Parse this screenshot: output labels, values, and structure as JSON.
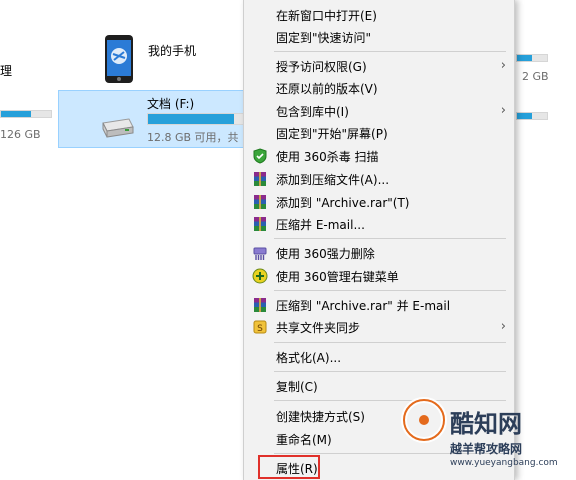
{
  "explorer": {
    "left_partial_text": "理",
    "left_partial_size": "126 GB",
    "phone": {
      "label": "我的手机"
    },
    "drive": {
      "label": "文档 (F:)",
      "free_text": "12.8 GB 可用，共",
      "usage": 0.88
    },
    "right_partial_size": "2 GB",
    "right_bars": [
      {
        "usage": 0.5
      },
      {
        "usage": 0.5
      }
    ]
  },
  "context_menu": {
    "items": [
      {
        "label": "在新窗口中打开(E)",
        "icon": ""
      },
      {
        "label": "固定到\"快速访问\"",
        "icon": ""
      },
      {
        "label": "授予访问权限(G)",
        "icon": "",
        "submenu": true
      },
      {
        "label": "还原以前的版本(V)",
        "icon": ""
      },
      {
        "label": "包含到库中(I)",
        "icon": "",
        "submenu": true
      },
      {
        "label": "固定到\"开始\"屏幕(P)",
        "icon": ""
      },
      {
        "label": "使用 360杀毒 扫描",
        "icon": "shield-icon"
      },
      {
        "label": "添加到压缩文件(A)...",
        "icon": "winrar-icon"
      },
      {
        "label": "添加到 \"Archive.rar\"(T)",
        "icon": "winrar-icon"
      },
      {
        "label": "压缩并 E-mail...",
        "icon": "winrar-icon"
      },
      {
        "label": "使用 360强力删除",
        "icon": "shredder-icon"
      },
      {
        "label": "使用 360管理右键菜单",
        "icon": "context-manager-icon"
      },
      {
        "label": "压缩到 \"Archive.rar\" 并 E-mail",
        "icon": "winrar-icon"
      },
      {
        "label": "共享文件夹同步",
        "icon": "sync-icon",
        "submenu": true
      },
      {
        "label": "格式化(A)...",
        "icon": ""
      },
      {
        "label": "复制(C)",
        "icon": ""
      },
      {
        "label": "创建快捷方式(S)",
        "icon": ""
      },
      {
        "label": "重命名(M)",
        "icon": ""
      },
      {
        "label": "属性(R)",
        "icon": ""
      }
    ],
    "submenu_arrow": "›",
    "highlight_color": "#e0302a"
  },
  "watermark": {
    "line1": "酷知网",
    "line2": "越羊帮攻略网",
    "line3": "www.yueyangbang.com"
  },
  "colors": {
    "selection": "#cce8ff",
    "drive_bar": "#26a0da"
  }
}
